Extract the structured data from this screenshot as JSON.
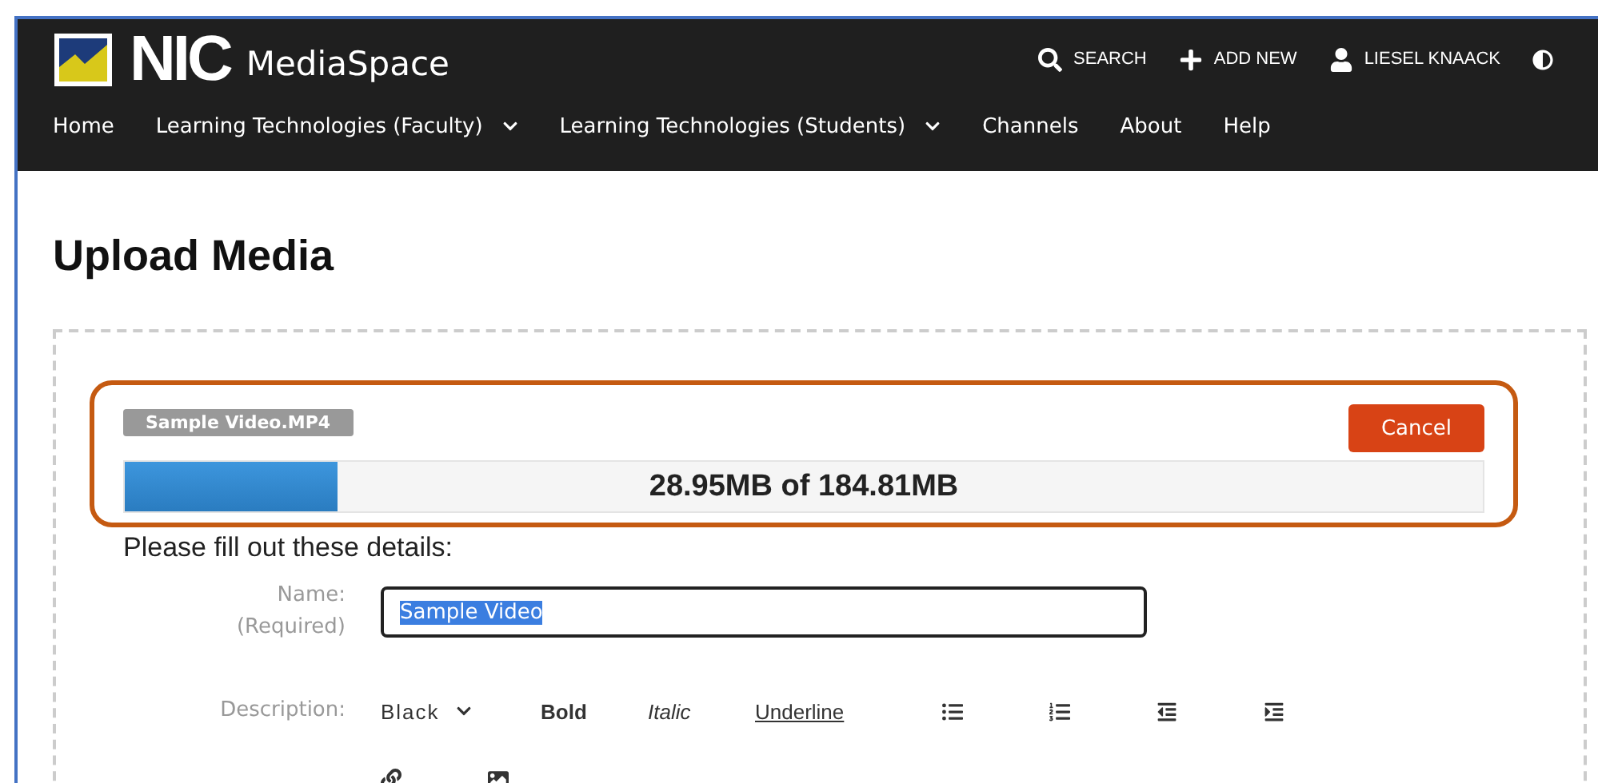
{
  "header": {
    "brand": "NIC",
    "product": "MediaSpace",
    "actions": [
      {
        "kind": "search",
        "label": "SEARCH"
      },
      {
        "kind": "add",
        "label": "ADD NEW"
      },
      {
        "kind": "user",
        "label": "LIESEL KNAACK"
      },
      {
        "kind": "contrast"
      }
    ],
    "nav": [
      {
        "label": "Home",
        "dropdown": false
      },
      {
        "label": "Learning Technologies (Faculty)",
        "dropdown": true
      },
      {
        "label": "Learning Technologies (Students)",
        "dropdown": true
      },
      {
        "label": "Channels",
        "dropdown": false
      },
      {
        "label": "About",
        "dropdown": false
      },
      {
        "label": "Help",
        "dropdown": false
      }
    ]
  },
  "page": {
    "title": "Upload Media"
  },
  "upload": {
    "file_name": "Sample Video.MP4",
    "cancel": "Cancel",
    "level": 0.157,
    "progress_text": "28.95MB of 184.81MB"
  },
  "details": {
    "heading": "Please fill out these details:",
    "name_label": "Name:",
    "name_required": "(Required)",
    "name_value": "Sample Video",
    "name_selected": true,
    "description_label": "Description:",
    "toolbar": [
      {
        "kind": "select",
        "label": "Black"
      },
      {
        "kind": "bold",
        "label": "Bold"
      },
      {
        "kind": "italic",
        "label": "Italic"
      },
      {
        "kind": "underline",
        "label": "Underline"
      },
      {
        "kind": "bullet-list"
      },
      {
        "kind": "numbered-list"
      },
      {
        "kind": "outdent"
      },
      {
        "kind": "indent"
      },
      {
        "kind": "link"
      },
      {
        "kind": "image"
      }
    ]
  }
}
